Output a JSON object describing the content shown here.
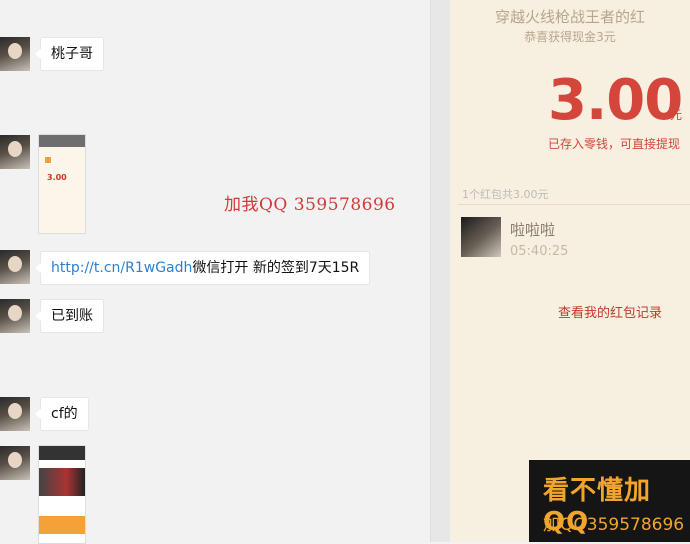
{
  "chat": {
    "messages": [
      {
        "type": "text",
        "text": "桃子哥"
      },
      {
        "type": "image",
        "amount": "3.00"
      },
      {
        "type": "link",
        "url": "http://t.cn/R1wGadh",
        "text": "微信打开 新的签到7天15R"
      },
      {
        "type": "text",
        "text": "已到账"
      },
      {
        "type": "text",
        "text": "cf的"
      },
      {
        "type": "image"
      }
    ],
    "overlay_text": "加我QQ 359578696"
  },
  "red_packet": {
    "title": "穿越火线枪战王者的红",
    "subtitle": "恭喜获得现金3元",
    "amount": "3.00",
    "unit": "元",
    "note": "已存入零钱，可直接提现",
    "count_text": "1个红包共3.00元",
    "recipient": {
      "name": "啦啦啦",
      "time": "05:40:25"
    },
    "history_link": "查看我的红包记录"
  },
  "badge": {
    "line1": "看不懂加QQ",
    "line2": "加QQ359578696"
  }
}
